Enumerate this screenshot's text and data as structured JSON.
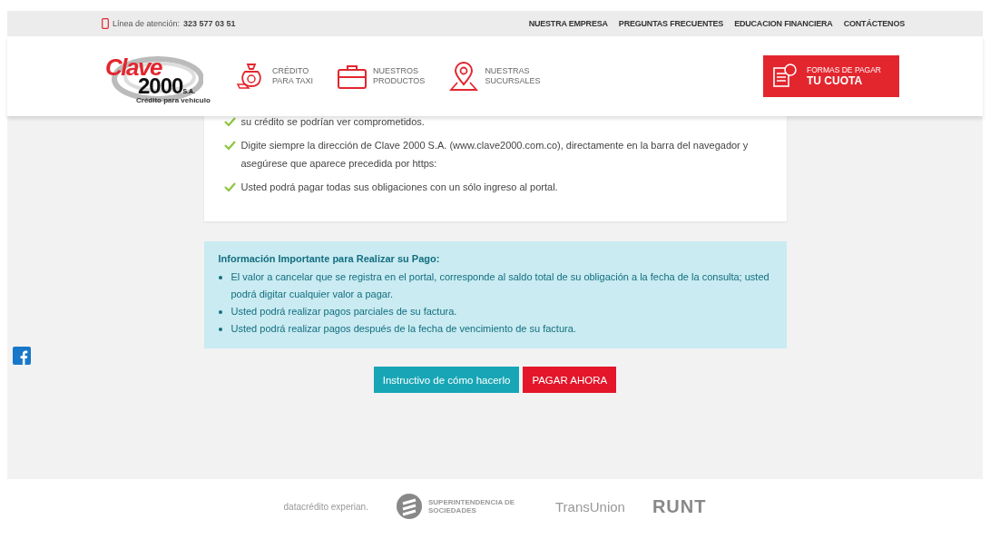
{
  "top_bar": {
    "hotline_label": "Línea de atención:",
    "hotline_number": "323 577 03 51",
    "links": [
      "NUESTRA EMPRESA",
      "PREGUNTAS FRECUENTES",
      "EDUCACION FINANCIERA",
      "CONTÁCTENOS"
    ]
  },
  "header": {
    "logo": {
      "word": "Clave",
      "number": "2000",
      "suffix": "S.A.",
      "tagline": "Crédito para vehículo"
    },
    "nav": [
      {
        "kind": "money",
        "lines": [
          "CRÉDITO",
          "PARA TAXI"
        ]
      },
      {
        "kind": "briefcase",
        "lines": [
          "NUESTROS",
          "PRODUCTOS"
        ]
      },
      {
        "kind": "pin",
        "lines": [
          "NUESTRAS",
          "SUCURSALES"
        ]
      }
    ],
    "cta": {
      "line1": "FORMAS DE PAGAR",
      "line2": "TU CUOTA"
    }
  },
  "tips": [
    {
      "checked": true,
      "text": "su crédito se podrían ver comprometidos."
    },
    {
      "checked": true,
      "text": "Digite siempre la dirección de Clave 2000 S.A. (www.clave2000.com.co), directamente en la barra del navegador y asegúrese que aparece precedida por https:"
    },
    {
      "checked": true,
      "text": "Usted podrá pagar todas sus obligaciones con un sólo ingreso al portal."
    }
  ],
  "info": {
    "title": "Información Importante para Realizar su Pago:",
    "items": [
      "El valor a cancelar que se registra en el portal, corresponde al saldo total de su obligación a la fecha de la consulta; usted podrá digitar cualquier valor a pagar.",
      "Usted podrá realizar pagos parciales de su factura.",
      "Usted podrá realizar pagos después de la fecha de vencimiento de su factura."
    ]
  },
  "buttons": [
    {
      "kind": "secondary",
      "label": "Instructivo de cómo hacerlo"
    },
    {
      "kind": "primary",
      "label": "PAGAR AHORA"
    }
  ],
  "footer_logos": [
    {
      "kind": "datacredito",
      "text": "datacrédito experian."
    },
    {
      "kind": "supersociedades",
      "text": "SUPERINTENDENCIA DE SOCIEDADES"
    },
    {
      "kind": "transunion",
      "text": "TransUnion"
    },
    {
      "kind": "runt",
      "text": "RUNT"
    }
  ]
}
